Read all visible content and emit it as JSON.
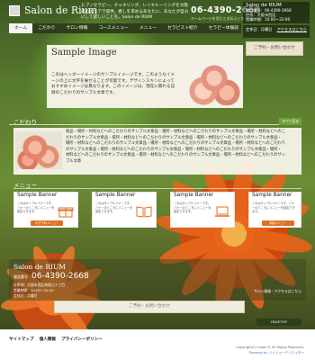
{
  "header": {
    "logo": "Salon de Rium",
    "tagline": "ヒプノセラピー、チャネリング、レイキヒーリングを大阪府のエリアで提供。癒しを求めるあなたに、あなたが自分にして欲しいことを。Salon de RIUM",
    "phone": "06-4390-2668",
    "hours": "ホームページを見たとお伝えください"
  },
  "info": {
    "title": "Salon de RIUM",
    "lines": [
      "電話番号：06-4390-2668",
      "住所：大阪市西区",
      "営業時間：10:00〜22:00",
      "定休日：月曜日"
    ],
    "link": "アクセスはこちら"
  },
  "nav": [
    "ホーム",
    "こだわり",
    "サロン情報",
    "コースメニュー",
    "メニュー",
    "セラピスト紹介",
    "セラピー体験談"
  ],
  "contact_button": "ご予約・お問い合わせ",
  "hero": {
    "title": "Sample Image",
    "text": "このはヘッダーイメージのサンプルイメージです。このようなイメージの上に文字を乗せることが可能です。デザインスキンによっておすすめイメージは異なります。このイメージは、現在に関わる記録のこだわりのサンプル文章です。"
  },
  "kodawari": {
    "title": "こだわり",
    "button": "すべて見る",
    "text": "商品・場所・材料などへのこだわりのサンプル文章品・場所・材料などへのこだわりのサンプル文章品・場所・材料などへのこだわりのサンプル文章品・場所・材料などへのこだわりのサンプル文章品・場所・材料などへのこだわりのサンプル文章品・場所・材料などへのこだわりのサンプル文章品・場所・材料などへのこだわりのサンプル文章品・場所・材料などへのこだわりのサンプル文章品・場所・材料などへのこだわりのサンプル文章品・場所・材料などへのこだわりのサンプル文章品・場所・材料などへのこだわりのサンプル文章品・場所・材料などへのこだわりのサンプル文章品・場所・材料などへのこだわりのサンプル文章"
  },
  "menu": {
    "title": "メニュー",
    "banners": [
      {
        "title": "Sample Banner",
        "text": "このはサンプルバナーです。バナーのところにメニューを設定できます。",
        "button": "おすすめメニュー",
        "icon": "gift-icon"
      },
      {
        "title": "Sample Banner",
        "text": "このはサンプルバナーです。バナーのところにメニューを設定できます。",
        "button": "",
        "icon": "book-icon"
      },
      {
        "title": "Sample Banner",
        "text": "このはサンプルバナーです。バナーのところにメニューを設定できます。",
        "button": "",
        "icon": "laptop-icon"
      },
      {
        "title": "Sample Banner",
        "text": "このはサンプルバナーです。バナーのところにメニューを設定できます。",
        "button": "新着メニュー",
        "icon": "flower-icon"
      }
    ]
  },
  "footer": {
    "name": "Salon de RIUM",
    "phone_label": "電話番号",
    "phone": "06-4390-2668",
    "lines": [
      "住所地：大阪市西区南堀江２丁目",
      "営業時間：10:00〜22:00",
      "定休日：月曜日"
    ],
    "sitemap": "サロン情報・アクセスはこちら",
    "button": "ご予約・お問い合わせ",
    "pagetop": "PAGETOP"
  },
  "bottom": {
    "links": [
      "サイトマップ",
      "個人情報",
      "プライバシーポリシー"
    ],
    "copyright": "Copyright(C) Salon R. All Rights Reserved.",
    "powered": "Powered by ジンドゥークリエイター"
  },
  "colors": {
    "nav_bg": "#2d3f1a",
    "accent": "#e07022",
    "green": "#6fa33a"
  }
}
